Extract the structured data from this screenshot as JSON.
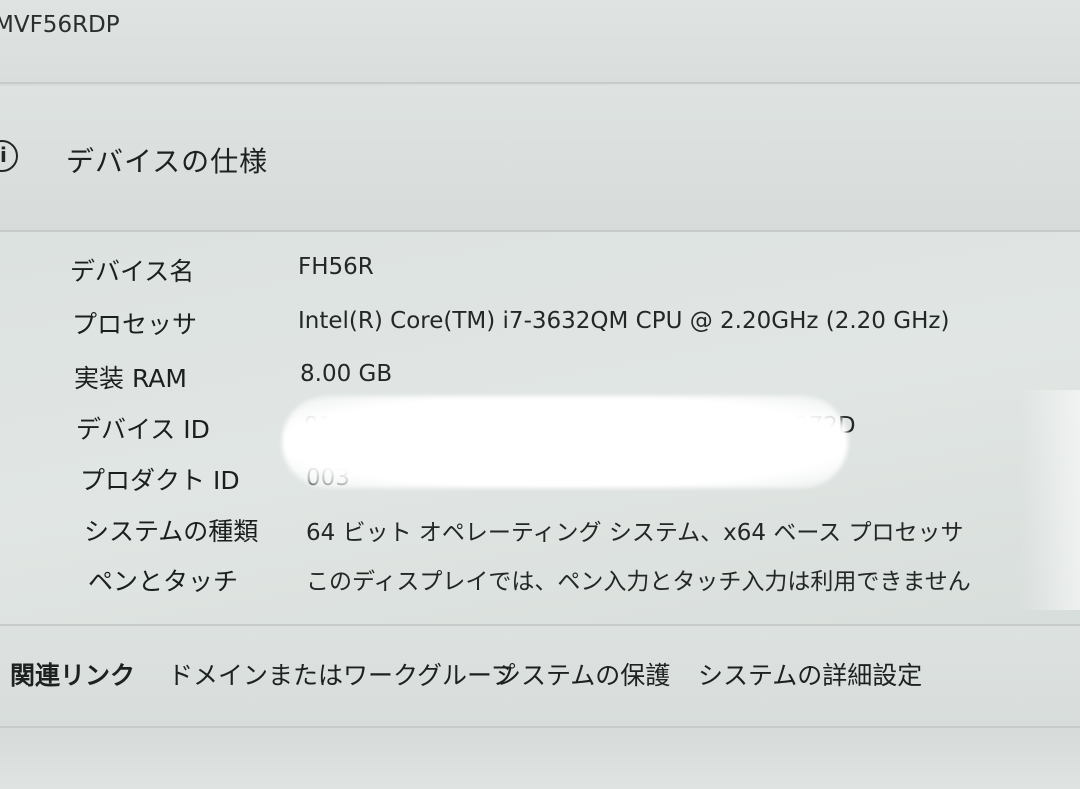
{
  "window": {
    "title": "MVF56RDP"
  },
  "section": {
    "icon": "info-icon",
    "title": "デバイスの仕様"
  },
  "specs": {
    "device_name": {
      "label": "デバイス名",
      "value": "FH56R"
    },
    "processor": {
      "label": "プロセッサ",
      "value": "Intel(R) Core(TM) i7-3632QM CPU @ 2.20GHz (2.20 GHz)"
    },
    "ram": {
      "label": "実装 RAM",
      "value": "8.00 GB"
    },
    "device_id": {
      "label": "デバイス ID",
      "value_start": "91",
      "value_end": "972D"
    },
    "product_id": {
      "label": "プロダクト ID",
      "value_start": "003"
    },
    "system_type": {
      "label": "システムの種類",
      "value": "64 ビット オペレーティング システム、x64 ベース プロセッサ"
    },
    "pen_touch": {
      "label": "ペンとタッチ",
      "value": "このディスプレイでは、ペン入力とタッチ入力は利用できません"
    }
  },
  "related_links": {
    "heading": "関連リンク",
    "domain": "ドメインまたはワークグループ",
    "protection": "システムの保護",
    "advanced": "システムの詳細設定"
  }
}
